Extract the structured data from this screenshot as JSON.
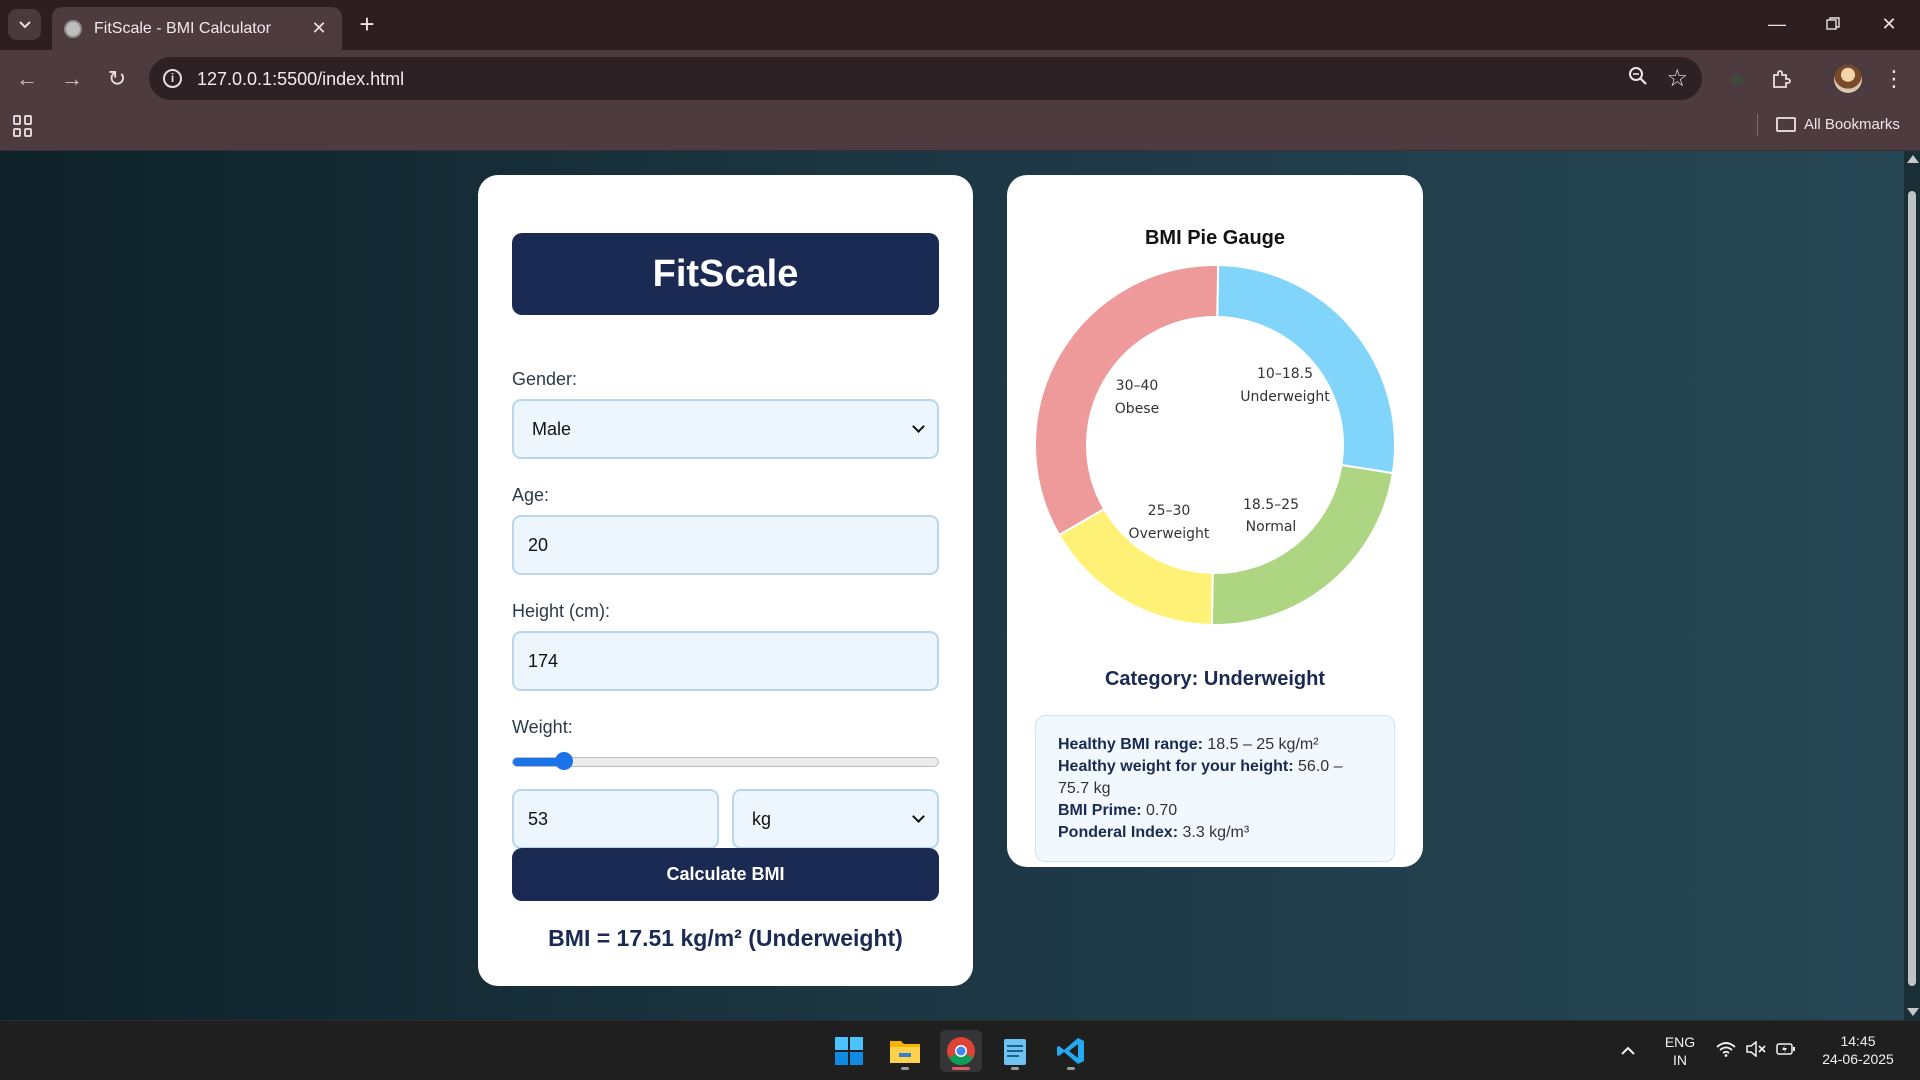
{
  "browser": {
    "tab_title": "FitScale - BMI Calculator",
    "url": "127.0.0.1:5500/index.html",
    "bookmarks_label": "All Bookmarks"
  },
  "calculator": {
    "title": "FitScale",
    "gender_label": "Gender:",
    "gender_value": "Male",
    "age_label": "Age:",
    "age_value": "20",
    "height_label": "Height (cm):",
    "height_value": "174",
    "weight_label": "Weight:",
    "weight_value": "53",
    "weight_unit": "kg",
    "weight_slider_fraction": 0.12,
    "calculate_label": "Calculate BMI",
    "result_text": "BMI = 17.51 kg/m² (Underweight)"
  },
  "gauge": {
    "title": "BMI Pie Gauge",
    "segments": [
      {
        "range": "10–18.5",
        "name": "Underweight",
        "color": "#81d4fa"
      },
      {
        "range": "18.5–25",
        "name": "Normal",
        "color": "#aed581"
      },
      {
        "range": "25–30",
        "name": "Overweight",
        "color": "#fff176"
      },
      {
        "range": "30–40",
        "name": "Obese",
        "color": "#ef9a9a"
      }
    ],
    "category_text": "Category: Underweight",
    "info": {
      "healthy_range_label": "Healthy BMI range:",
      "healthy_range_value": "18.5 – 25 kg/m²",
      "healthy_weight_label": "Healthy weight for your height:",
      "healthy_weight_value": "56.0 – 75.7 kg",
      "bmi_prime_label": "BMI Prime:",
      "bmi_prime_value": "0.70",
      "ponderal_label": "Ponderal Index:",
      "ponderal_value": "3.3 kg/m³"
    }
  },
  "taskbar": {
    "apps": [
      "start-icon",
      "file-explorer-icon",
      "chrome-icon",
      "notepad-icon",
      "vscode-icon"
    ],
    "language_top": "ENG",
    "language_bottom": "IN",
    "time": "14:45",
    "date": "24-06-2025"
  },
  "colors": {
    "accent_dark": "#1b2a52",
    "slider_blue": "#1a73e8"
  }
}
